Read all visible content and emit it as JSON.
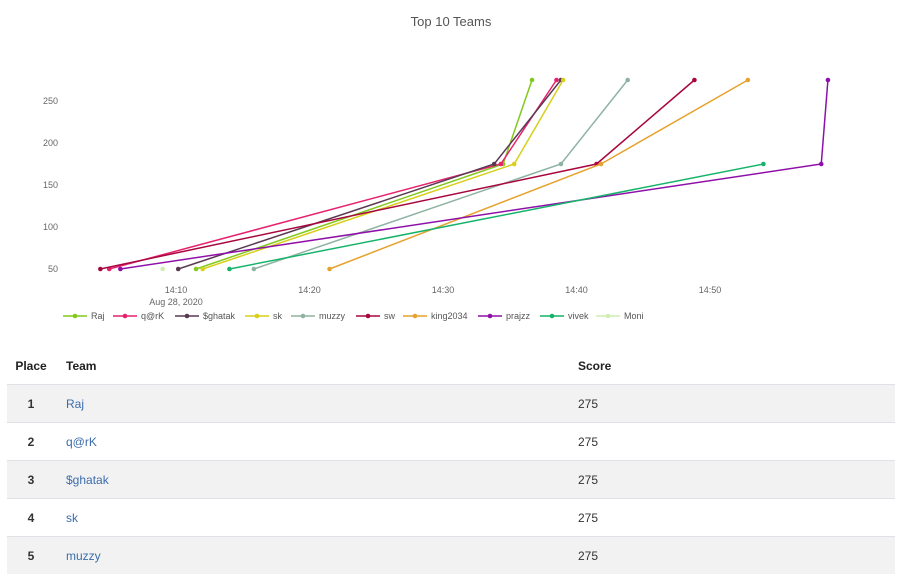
{
  "chart_data": {
    "type": "line",
    "title": "Top 10 Teams",
    "x_ticks": [
      "14:10",
      "14:20",
      "14:30",
      "14:40",
      "14:50"
    ],
    "x_date_label": "Aug 28, 2020",
    "y_ticks": [
      50,
      100,
      150,
      200,
      250
    ],
    "ylim": [
      40,
      280
    ],
    "xlim": [
      "14:10",
      "14:50"
    ],
    "grid": false,
    "legend_position": "bottom-left",
    "series": [
      {
        "name": "Raj",
        "color": "#82c91e",
        "x": [
          "14:11:30",
          "14:34:30",
          "14:36:40"
        ],
        "y": [
          50,
          175,
          275
        ]
      },
      {
        "name": "q@rK",
        "color": "#e6226e",
        "x": [
          "14:05:00",
          "14:34:20",
          "14:38:30"
        ],
        "y": [
          50,
          175,
          275
        ]
      },
      {
        "name": "$ghatak",
        "color": "#5a3a52",
        "x": [
          "14:10:10",
          "14:33:50",
          "14:38:50"
        ],
        "y": [
          50,
          175,
          275
        ]
      },
      {
        "name": "sk",
        "color": "#d7cf1a",
        "x": [
          "14:12:00",
          "14:35:20",
          "14:39:00"
        ],
        "y": [
          50,
          175,
          275
        ]
      },
      {
        "name": "muzzy",
        "color": "#8fb3a2",
        "x": [
          "14:15:50",
          "14:38:50",
          "14:43:50"
        ],
        "y": [
          50,
          175,
          275
        ]
      },
      {
        "name": "sw",
        "color": "#a8063e",
        "x": [
          "14:04:20",
          "14:41:30",
          "14:48:50"
        ],
        "y": [
          50,
          175,
          275
        ]
      },
      {
        "name": "king2034",
        "color": "#e6a22e",
        "x": [
          "14:21:30",
          "14:41:50",
          "14:52:50"
        ],
        "y": [
          50,
          175,
          275
        ]
      },
      {
        "name": "prajzz",
        "color": "#8e10a8",
        "x": [
          "14:05:50",
          "14:58:20",
          "14:58:50"
        ],
        "y": [
          50,
          175,
          275
        ]
      },
      {
        "name": "vivek",
        "color": "#16b46a",
        "x": [
          "14:14:00",
          "14:54:00"
        ],
        "y": [
          50,
          175
        ]
      },
      {
        "name": "Moni",
        "color": "#cfeeb0",
        "x": [
          "14:09:00"
        ],
        "y": [
          50
        ]
      }
    ]
  },
  "table": {
    "headers": {
      "place": "Place",
      "team": "Team",
      "score": "Score"
    },
    "rows": [
      {
        "place": "1",
        "team": "Raj",
        "score": "275"
      },
      {
        "place": "2",
        "team": "q@rK",
        "score": "275"
      },
      {
        "place": "3",
        "team": "$ghatak",
        "score": "275"
      },
      {
        "place": "4",
        "team": "sk",
        "score": "275"
      },
      {
        "place": "5",
        "team": "muzzy",
        "score": "275"
      }
    ]
  }
}
